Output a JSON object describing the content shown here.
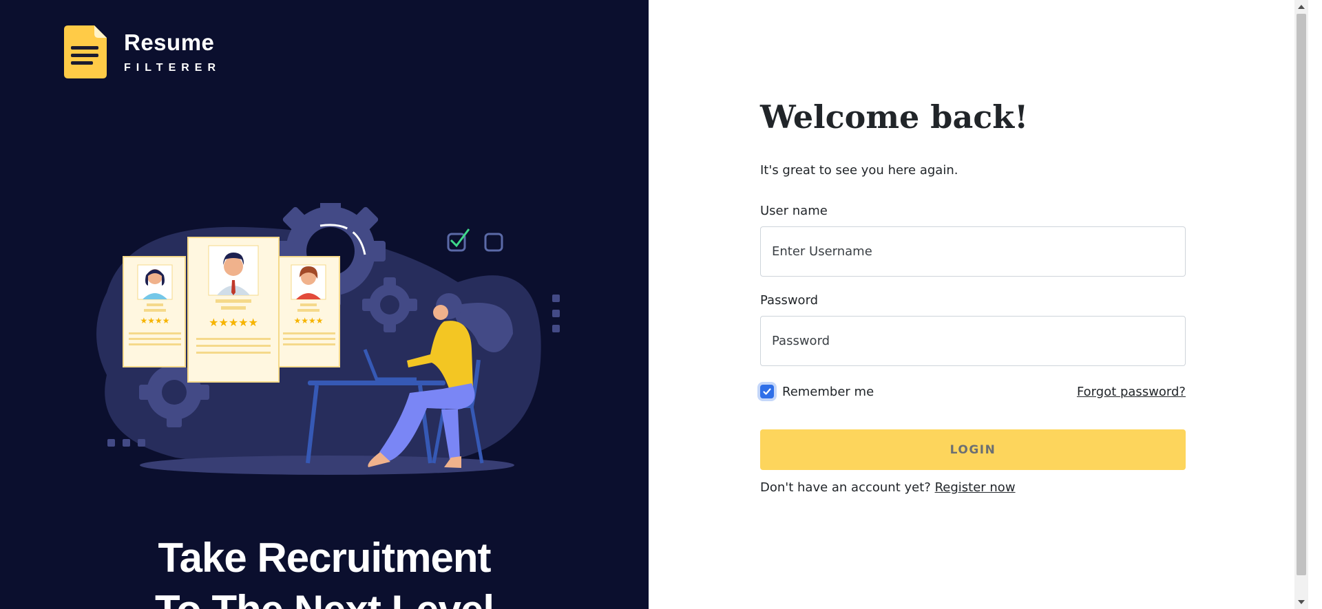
{
  "brand": {
    "name": "Resume",
    "tagline": "FILTERER",
    "color": "#ffcb47"
  },
  "hero": {
    "headline_line1": "Take Recruitment",
    "headline_line2": "To The Next Level",
    "background": "#0b0f2e"
  },
  "login": {
    "title": "Welcome back!",
    "subtitle": "It's great to see you here again.",
    "username_label": "User name",
    "username_placeholder": "Enter Username",
    "username_value": "",
    "password_label": "Password",
    "password_placeholder": "Password",
    "password_value": "",
    "remember_label": "Remember me",
    "remember_checked": true,
    "forgot_label": "Forgot password?",
    "login_button": "LOGIN",
    "no_account_text": "Don't have an account yet?",
    "register_label": "Register now"
  },
  "colors": {
    "accent": "#fdd55c",
    "checkbox": "#2f6fe8",
    "text": "#212529"
  }
}
